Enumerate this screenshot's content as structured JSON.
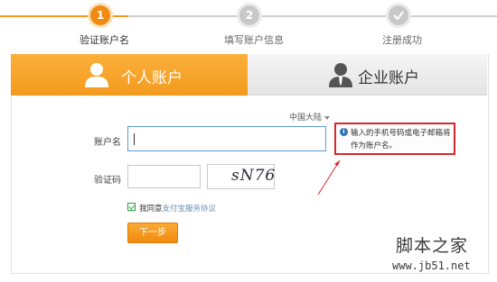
{
  "steps": [
    {
      "number": "1",
      "label": "验证账户名"
    },
    {
      "number": "2",
      "label": "填写账户信息"
    },
    {
      "number": "",
      "label": "注册成功"
    }
  ],
  "tabs": {
    "personal": "个人账户",
    "business": "企业账户"
  },
  "form": {
    "region": "中国大陆",
    "account_label": "账户名",
    "account_value": "",
    "tip": "输入的手机号码或电子邮箱将作为账户名。",
    "captcha_label": "验证码",
    "captcha_value": "",
    "captcha_text": "sN76",
    "agree_prefix": "我同意",
    "agree_link": "支付宝服务协议",
    "next_button": "下一步"
  },
  "watermark": {
    "logo_text": "脚本之家",
    "url": "www.jb51.net"
  },
  "colors": {
    "accent": "#f39a1e",
    "tip_border": "#d9252b",
    "input_focus": "#5b9bd5"
  }
}
